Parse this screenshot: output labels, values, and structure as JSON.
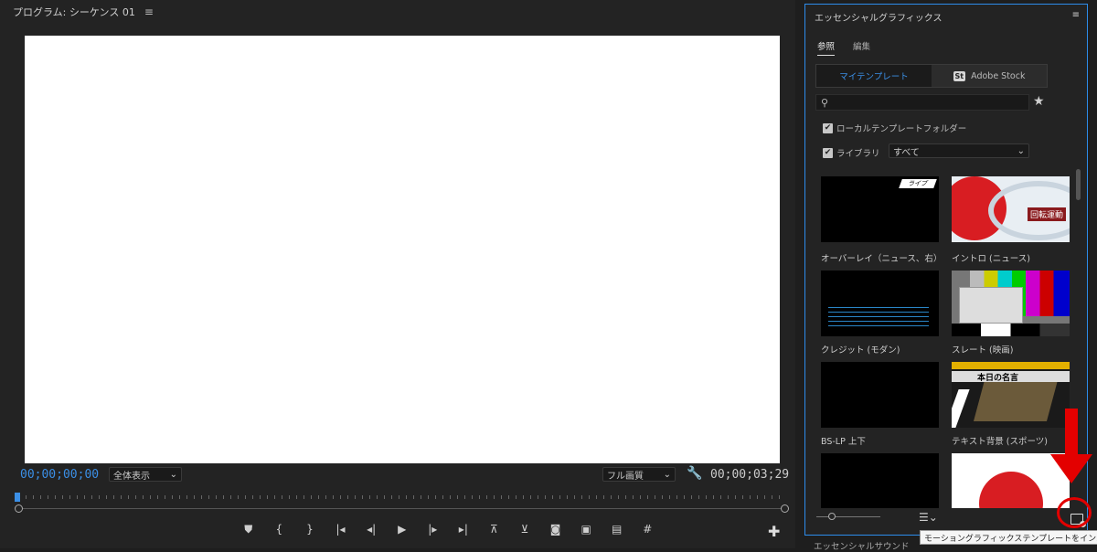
{
  "program_monitor": {
    "title": "プログラム: シーケンス 01",
    "timecode_current": "00;00;00;00",
    "fit": "全体表示",
    "quality": "フル画質",
    "timecode_duration": "00;00;03;29",
    "transport_icons": [
      "add-marker-icon",
      "mark-in-icon",
      "mark-out-icon",
      "go-to-in-icon",
      "step-back-icon",
      "play-icon",
      "step-forward-icon",
      "go-to-out-icon",
      "lift-icon",
      "extract-icon",
      "export-frame-icon",
      "comparison-view-icon",
      "proxy-icon",
      "safe-margins-icon"
    ],
    "transport_glyphs": [
      "⛊",
      "{",
      "}",
      "|◂",
      "◂|",
      "▶",
      "|▸",
      "▸|",
      "⊼",
      "⊻",
      "◙",
      "▣",
      "▤",
      "#"
    ]
  },
  "essential_graphics": {
    "title": "エッセンシャルグラフィックス",
    "tabs": [
      "参照",
      "編集"
    ],
    "segments": [
      "マイテンプレート",
      "Adobe Stock"
    ],
    "stock_badge": "St",
    "search_placeholder": "",
    "local_folder_label": "ローカルテンプレートフォルダー",
    "library_label": "ライブラリ",
    "library_value": "すべて",
    "templates": [
      {
        "caption": "オーバーレイ（ニュース、右）"
      },
      {
        "caption": "イントロ (ニュース)"
      },
      {
        "caption": "クレジット (モダン)"
      },
      {
        "caption": "スレート (映画)"
      },
      {
        "caption": "BS-LP 上下"
      },
      {
        "caption": "テキスト背景 (スポーツ)"
      },
      {
        "caption": ""
      },
      {
        "caption": ""
      }
    ],
    "thumb_texts": {
      "live": "ライブ",
      "rotation": "回転運動",
      "today": "本日の名言"
    },
    "install_tooltip": "モーショングラフィックステンプレートをインストール"
  },
  "bottom_panel_label": "エッセンシャルサウンド",
  "colors": {
    "accent": "#3b8fe6",
    "annotation": "#e30000"
  }
}
